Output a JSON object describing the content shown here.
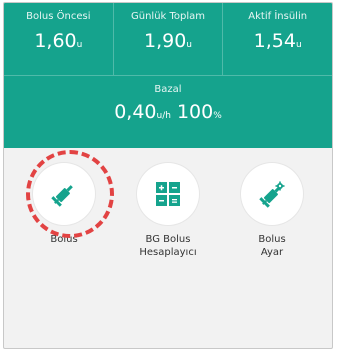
{
  "stats": {
    "bolus_previous": {
      "label": "Bolus Öncesi",
      "value": "1,60",
      "unit": "u"
    },
    "daily_total": {
      "label": "Günlük Toplam",
      "value": "1,90",
      "unit": "u"
    },
    "active_insulin": {
      "label": "Aktif İnsülin",
      "value": "1,54",
      "unit": "u"
    }
  },
  "basal": {
    "label": "Bazal",
    "rate": "0,40",
    "rate_unit": "u/h",
    "percent": "100",
    "percent_unit": "%"
  },
  "actions": [
    {
      "label": "Bolus",
      "icon": "syringe-icon"
    },
    {
      "label_line1": "BG Bolus",
      "label_line2": "Hesaplayıcı",
      "icon": "calculator-icon"
    },
    {
      "label_line1": "Bolus",
      "label_line2": "Ayar",
      "icon": "syringe-gear-icon"
    }
  ],
  "colors": {
    "teal": "#15a38d",
    "highlight": "#e24343"
  }
}
